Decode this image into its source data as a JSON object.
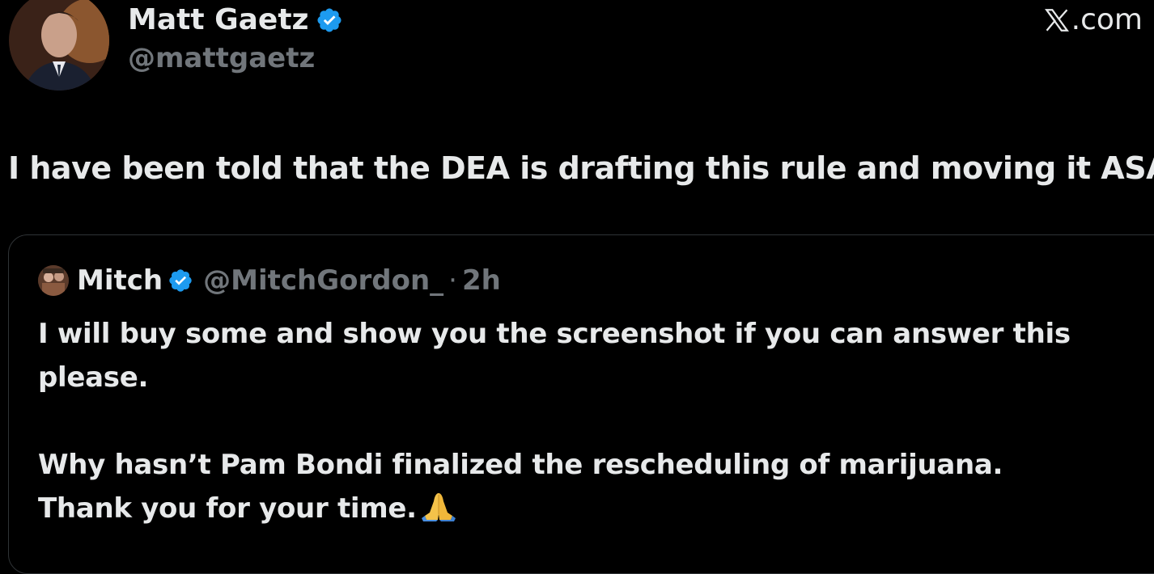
{
  "author": {
    "name": "Matt Gaetz",
    "handle": "@mattgaetz",
    "verified": true,
    "avatar_icon": "profile-photo"
  },
  "brand": {
    "label": ".com",
    "logo_icon": "x-logo-icon"
  },
  "tweet": {
    "text": "I have been told that the DEA is drafting this rule and moving it ASAP."
  },
  "quoted_tweet": {
    "author_name": "Mitch",
    "author_handle": "@MitchGordon_",
    "separator": "·",
    "time": "2h",
    "verified": true,
    "body_lines": [
      "I will buy some and show you the screenshot if you can answer this",
      "please.",
      "",
      "Why hasn’t Pam Bondi finalized the rescheduling of marijuana.",
      "Thank you for your time."
    ],
    "trailing_emoji": "folded-hands-icon"
  },
  "colors": {
    "background": "#000000",
    "primary_text": "#e7e9ea",
    "secondary_text": "#71767b",
    "verified_blue": "#1d9bf0",
    "card_border": "#2f3336"
  }
}
